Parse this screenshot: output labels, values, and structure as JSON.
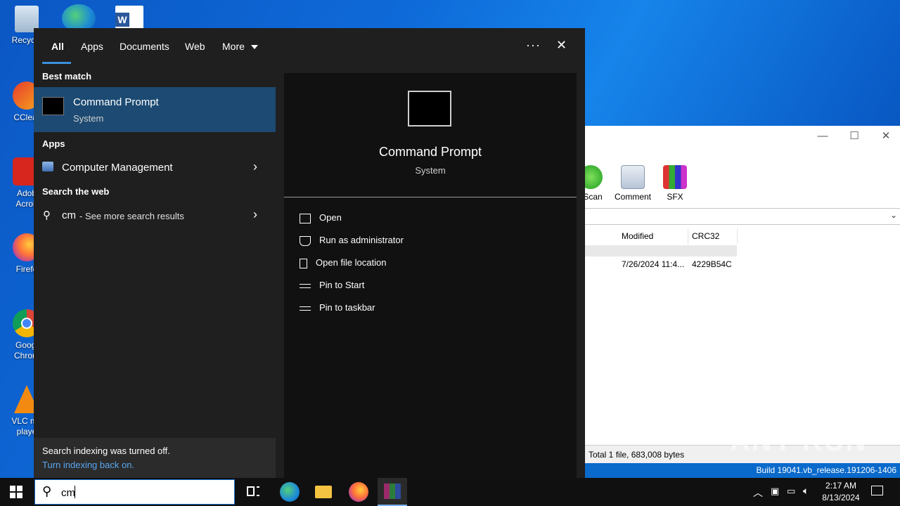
{
  "desktop": {
    "icons": [
      {
        "label": "Recycle"
      },
      {
        "label": "CClear"
      },
      {
        "label": "Adob Acrob"
      },
      {
        "label": "Firefo"
      },
      {
        "label": "Googl Chrom"
      },
      {
        "label": "VLC me playe"
      }
    ]
  },
  "winrar": {
    "toolbar": [
      {
        "label": "sScan"
      },
      {
        "label": "Comment"
      },
      {
        "label": "SFX"
      }
    ],
    "columns": [
      "Modified",
      "CRC32"
    ],
    "row": {
      "modified": "7/26/2024 11:4...",
      "crc": "4229B54C"
    },
    "status": "Total 1 file, 683,008 bytes",
    "build": "Build 19041.vb_release.191206-1406"
  },
  "startmenu": {
    "tabs": [
      {
        "label": "All"
      },
      {
        "label": "Apps"
      },
      {
        "label": "Documents"
      },
      {
        "label": "Web"
      },
      {
        "label": "More"
      }
    ],
    "more_glyph": "···",
    "close_glyph": "✕",
    "best_match_heading": "Best match",
    "best_match": {
      "title": "Command Prompt",
      "subtitle": "System"
    },
    "apps_heading": "Apps",
    "apps": [
      {
        "label": "Computer Management"
      }
    ],
    "web_heading": "Search the web",
    "web_query": "cm",
    "web_suffix": "- See more search results",
    "preview": {
      "title": "Command Prompt",
      "subtitle": "System"
    },
    "actions": [
      {
        "label": "Open",
        "icon": "open-icon"
      },
      {
        "label": "Run as administrator",
        "icon": "shield-icon"
      },
      {
        "label": "Open file location",
        "icon": "file-icon"
      },
      {
        "label": "Pin to Start",
        "icon": "pin-icon"
      },
      {
        "label": "Pin to taskbar",
        "icon": "pin-icon"
      }
    ],
    "indexing_msg": "Search indexing was turned off.",
    "indexing_link": "Turn indexing back on."
  },
  "taskbar": {
    "search_value": "cm",
    "time": "2:17 AM",
    "date": "8/13/2024"
  },
  "watermark": "ANY RUN",
  "colors": {
    "accent": "#3b8fd9",
    "highlight": "#1c4a72",
    "link": "#5aa6f0"
  }
}
